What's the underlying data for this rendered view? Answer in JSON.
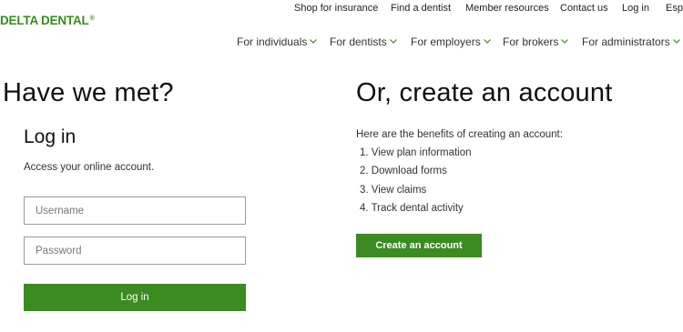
{
  "brand": {
    "logo_text": "DELTA DENTAL",
    "reg_mark": "®"
  },
  "utility_nav": [
    "Shop for insurance",
    "Find a dentist",
    "Member resources",
    "Contact us",
    "Log in",
    "Espa"
  ],
  "main_nav": [
    "For individuals",
    "For dentists",
    "For employers",
    "For brokers",
    "For administrators"
  ],
  "login_section": {
    "heading": "Have we met?",
    "title": "Log in",
    "subtitle": "Access your online account.",
    "username_placeholder": "Username",
    "password_placeholder": "Password",
    "button_label": "Log in"
  },
  "create_section": {
    "heading": "Or, create an account",
    "intro": "Here are the benefits of creating an account:",
    "benefits": [
      "1. View plan information",
      "2. Download forms",
      "3. View claims",
      "4. Track dental activity"
    ],
    "button_label": "Create an account"
  },
  "colors": {
    "brand_green": "#3b8a1f",
    "button_green": "#3b8a22",
    "chevron_green": "#3b8a22"
  }
}
